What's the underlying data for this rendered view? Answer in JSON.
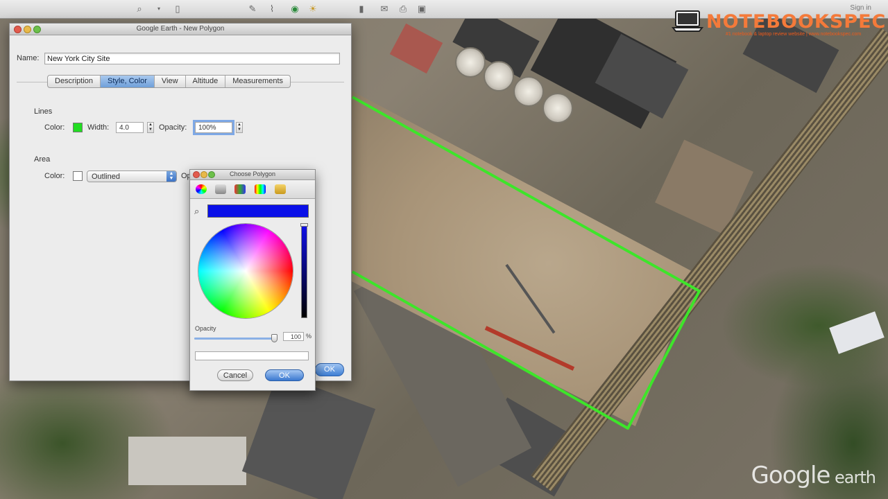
{
  "toolbar": {
    "signin_label": "Sign in"
  },
  "watermark": {
    "brand_a": "NOTEBOOK",
    "brand_b": "SPEC",
    "tagline": "#1 notebook & laptop review website | www.notebookspec.com"
  },
  "map": {
    "logo_google": "Google",
    "logo_earth": "earth"
  },
  "dialog": {
    "title": "Google Earth - New Polygon",
    "name_label": "Name:",
    "name_value": "New York City Site",
    "tabs": [
      "Description",
      "Style, Color",
      "View",
      "Altitude",
      "Measurements"
    ],
    "active_tab": "Style, Color",
    "lines": {
      "heading": "Lines",
      "color_label": "Color:",
      "color": "#22dd22",
      "width_label": "Width:",
      "width_value": "4.0",
      "opacity_label": "Opacity:",
      "opacity_value": "100%"
    },
    "area": {
      "heading": "Area",
      "color_label": "Color:",
      "color": "#ffffff",
      "fill_value": "Outlined",
      "opacity_label_partial": "Op"
    },
    "ok_label": "OK"
  },
  "color_picker": {
    "title": "Choose Polygon",
    "current_color": "#0a10e8",
    "opacity_label": "Opacity",
    "opacity_value": "100",
    "opacity_unit": "%",
    "opacity_level": 1.0,
    "cancel_label": "Cancel",
    "ok_label": "OK"
  },
  "colors": {
    "polygon_outline": "#3de52a",
    "accent_blue": "#3a78cf"
  }
}
